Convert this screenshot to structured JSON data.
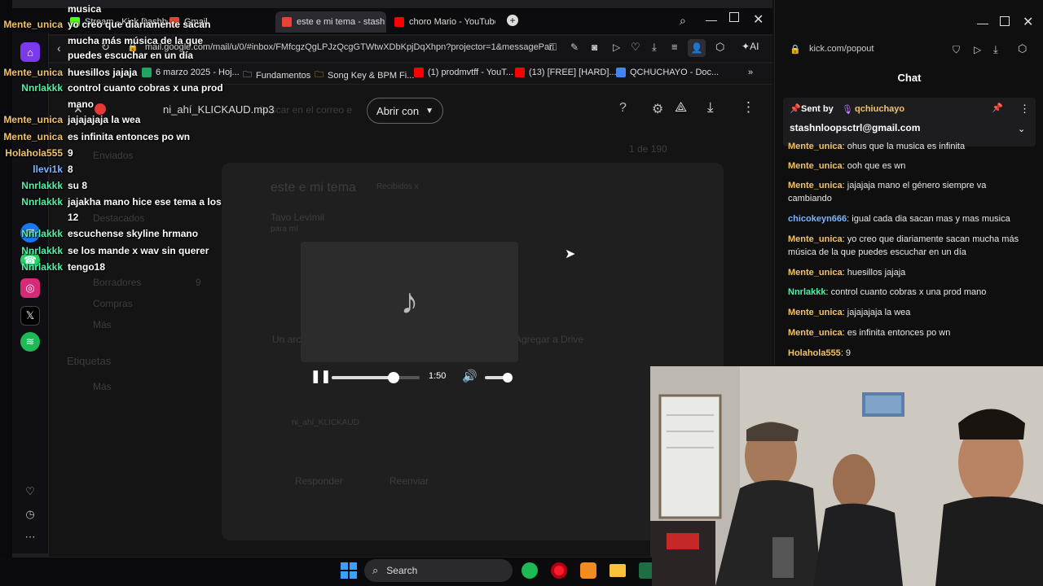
{
  "tabs": [
    {
      "label": "Stream - Kick Dashbo",
      "active": false
    },
    {
      "label": "Gmail",
      "active": false
    },
    {
      "label": "este e mi tema - stash",
      "active": true
    },
    {
      "label": "choro Mario - YouTube",
      "active": false
    }
  ],
  "url": "mail.google.com/mail/u/0/#inbox/FMfcgzQgLPJzQcgGTWtwXDbKpjDqXhpn?projector=1&messagePar",
  "ai_label": "AI",
  "bookmarks": [
    "6 marzo 2025 - Hoj...",
    "Fundamentos",
    "Song Key & BPM Fi...",
    "(1) prodmvtff - YouT...",
    "(13) [FREE] [HARD]...",
    "QCHUCHAYO - Doc..."
  ],
  "preview": {
    "file_name": "ni_ahí_KLICKAUD.mp3",
    "open_with": "Abrir con",
    "time": "1:50",
    "seek_progress": 0.7
  },
  "gmail_dimmed": {
    "search_placeholder": "Buscar en el correo e",
    "subject": "este e mi tema",
    "inbox_badge": "Recibidos x",
    "sender": "Tavo Levimil",
    "sender_to": "para mí",
    "pages": "1 de 190",
    "sidebar": [
      "Destacados",
      "Borradores",
      "Compras",
      "Más"
    ],
    "drafts_count": "9",
    "labels_title": "Etiquetas",
    "labels_more": "Más",
    "reply": "Responder",
    "forward": "Reenviar",
    "attachment_hint": "Un archivo adjunto",
    "drive_hint": "Agregar a Drive",
    "attachment_name": "ni_ahí_KLICKAUD"
  },
  "overlay_chat": [
    {
      "user": "",
      "msg": "musica",
      "color": "#ffffff"
    },
    {
      "user": "Mente_unica",
      "msg": "yo creo que diariamente sacan",
      "color": "#f0c36b"
    },
    {
      "user": "",
      "msg": "mucha más música de la que",
      "color": "#ffffff"
    },
    {
      "user": "",
      "msg": "puedes escuchar en un día",
      "color": "#ffffff"
    },
    {
      "user": "Mente_unica",
      "msg": "huesillos jajaja",
      "color": "#f0c36b"
    },
    {
      "user": "Nnrlakkk",
      "msg": "control cuanto cobras x una prod",
      "color": "#53f0a6"
    },
    {
      "user": "",
      "msg": "mano",
      "color": "#ffffff"
    },
    {
      "user": "Mente_unica",
      "msg": "jajajajaja la wea",
      "color": "#f0c36b"
    },
    {
      "user": "Mente_unica",
      "msg": "es infinita entonces po wn",
      "color": "#f0c36b"
    },
    {
      "user": "Holahola555",
      "msg": "9",
      "color": "#f0c36b"
    },
    {
      "user": "llevi1k",
      "msg": "8",
      "color": "#7ab6ff"
    },
    {
      "user": "Nnrlakkk",
      "msg": "su 8",
      "color": "#53f0a6"
    },
    {
      "user": "Nnrlakkk",
      "msg": "jajakha mano hice ese tema a los",
      "color": "#53f0a6"
    },
    {
      "user": "",
      "msg": "12",
      "color": "#ffffff"
    },
    {
      "user": "Nnrlakkk",
      "msg": "escuchense skyline hrmano",
      "color": "#53f0a6"
    },
    {
      "user": "Nnrlakkk",
      "msg": "se los mande x wav sin querer",
      "color": "#53f0a6"
    },
    {
      "user": "Nnrlakkk",
      "msg": "tengo18",
      "color": "#53f0a6"
    }
  ],
  "chat_popout": {
    "url": "kick.com/popout",
    "title": "Chat",
    "pinned_label": "Sent by",
    "pinned_user": "qchiuchayo",
    "pinned_message": "stashnloopsctrl@gmail.com",
    "messages": [
      {
        "user": "Mente_unica",
        "msg": ": ohus que la musica es infinita",
        "color": "#f0c36b"
      },
      {
        "user": "Mente_unica",
        "msg": ": ooh que es wn",
        "color": "#f0c36b"
      },
      {
        "user": "Mente_unica",
        "msg": ": jajajaja mano el género siempre va cambiando",
        "color": "#f0c36b"
      },
      {
        "user": "chicokeyn666",
        "msg": ": igual cada dia sacan mas y mas musica",
        "color": "#7ab6ff"
      },
      {
        "user": "Mente_unica",
        "msg": ": yo creo que diariamente sacan mucha más música de la que puedes escuchar en un día",
        "color": "#f0c36b"
      },
      {
        "user": "Mente_unica",
        "msg": ": huesillos jajaja",
        "color": "#f0c36b"
      },
      {
        "user": "Nnrlakkk",
        "msg": ": control cuanto cobras x una prod mano",
        "color": "#53f0a6"
      },
      {
        "user": "Mente_unica",
        "msg": ": jajajajaja la wea",
        "color": "#f0c36b"
      },
      {
        "user": "Mente_unica",
        "msg": ": es infinita entonces po wn",
        "color": "#f0c36b"
      },
      {
        "user": "Holahola555",
        "msg": ": 9",
        "color": "#f0c36b"
      }
    ]
  },
  "taskbar": {
    "search_label": "Search"
  }
}
